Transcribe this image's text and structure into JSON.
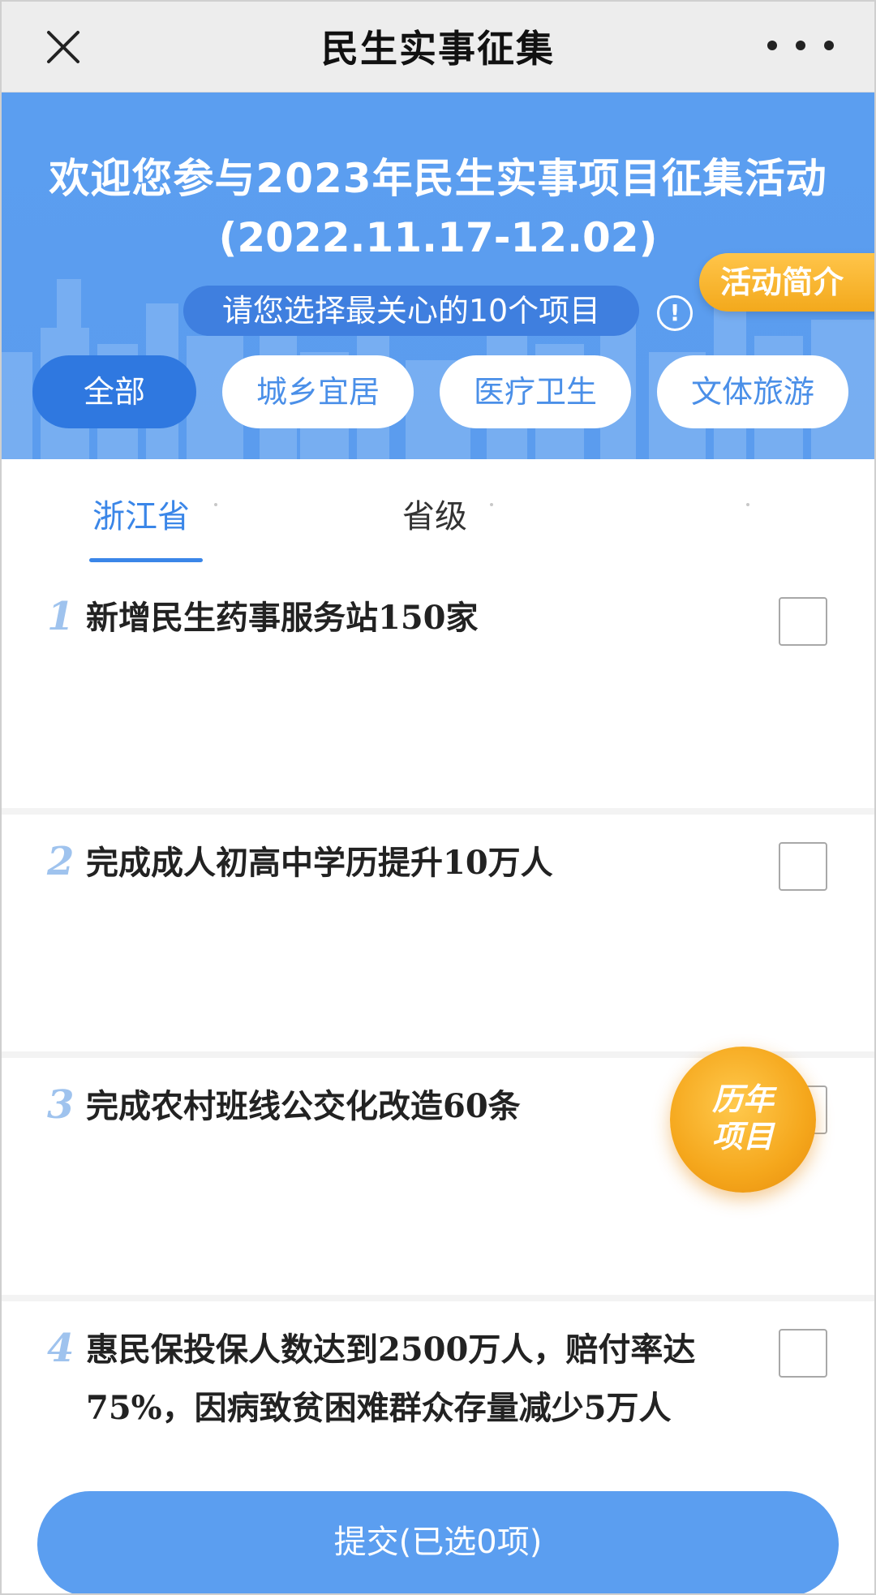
{
  "nav": {
    "title": "民生实事征集",
    "close_icon": "close-icon",
    "more_icon": "more-horizontal-icon"
  },
  "banner": {
    "title": "欢迎您参与2023年民生实事项目征集活动",
    "dates": "(2022.11.17-12.02)",
    "hint": "请您选择最关心的10个项目",
    "info_icon": "info-icon",
    "intro_label": "活动简介",
    "colors": {
      "banner": "#5b9ef0",
      "accent_orange": "#f5a71c"
    }
  },
  "categories": [
    {
      "label": "全部",
      "active": true
    },
    {
      "label": "城乡宜居",
      "active": false
    },
    {
      "label": "医疗卫生",
      "active": false
    },
    {
      "label": "文体旅游",
      "active": false
    }
  ],
  "subtabs": [
    {
      "label": "浙江省",
      "active": true
    },
    {
      "label": "省级",
      "active": false
    }
  ],
  "items": [
    {
      "number": "1",
      "text": "新增民生药事服务站150家",
      "checked": false
    },
    {
      "number": "2",
      "text": "完成成人初高中学历提升10万人",
      "checked": false
    },
    {
      "number": "3",
      "text": "完成农村班线公交化改造60条",
      "checked": false
    },
    {
      "number": "4",
      "text": "惠民保投保人数达到2500万人，赔付率达75%，因病致贫困难群众存量减少5万人",
      "checked": false
    }
  ],
  "badge": {
    "line1": "历年",
    "line2": "项目"
  },
  "submit": {
    "label": "提交(已选0项)"
  }
}
